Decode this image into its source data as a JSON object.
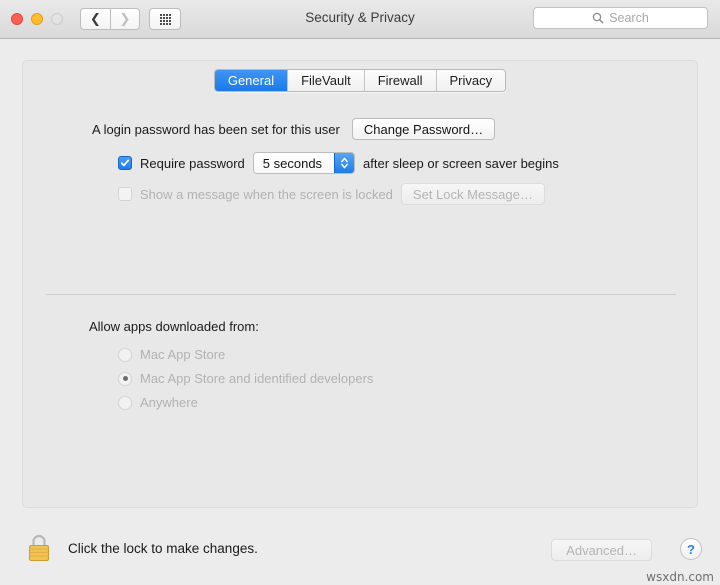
{
  "window": {
    "title": "Security & Privacy",
    "traffic_lights": [
      "close",
      "minimize",
      "zoom"
    ]
  },
  "toolbar": {
    "back_icon": "chevron-left-icon",
    "forward_icon": "chevron-right-icon",
    "grid_icon": "show-all-grid-icon",
    "search": {
      "placeholder": "Search",
      "icon": "search-icon",
      "value": ""
    }
  },
  "tabs": [
    {
      "label": "General",
      "active": true
    },
    {
      "label": "FileVault",
      "active": false
    },
    {
      "label": "Firewall",
      "active": false
    },
    {
      "label": "Privacy",
      "active": false
    }
  ],
  "general": {
    "login_password_status": "A login password has been set for this user",
    "change_password_button": "Change Password…",
    "require_password": {
      "checked": true,
      "label": "Require password",
      "delay_value": "5 seconds",
      "suffix": "after sleep or screen saver begins"
    },
    "lock_message": {
      "checked": false,
      "label": "Show a message when the screen is locked",
      "button": "Set Lock Message…",
      "enabled": false
    },
    "allow_apps": {
      "heading": "Allow apps downloaded from:",
      "options": [
        {
          "label": "Mac App Store",
          "selected": false
        },
        {
          "label": "Mac App Store and identified developers",
          "selected": true
        },
        {
          "label": "Anywhere",
          "selected": false
        }
      ],
      "enabled": false
    }
  },
  "footer": {
    "lock_icon": "padlock-closed-icon",
    "lock_text": "Click the lock to make changes.",
    "advanced_button": "Advanced…",
    "help_button": "?"
  },
  "watermark": "wsxdn.com",
  "colors": {
    "accent_blue": "#1f7de9",
    "window_bg": "#ececec",
    "panel_bg": "#e8e8e8",
    "lock_gold": "#f2c352",
    "disabled_text": "#b2b2b2"
  }
}
